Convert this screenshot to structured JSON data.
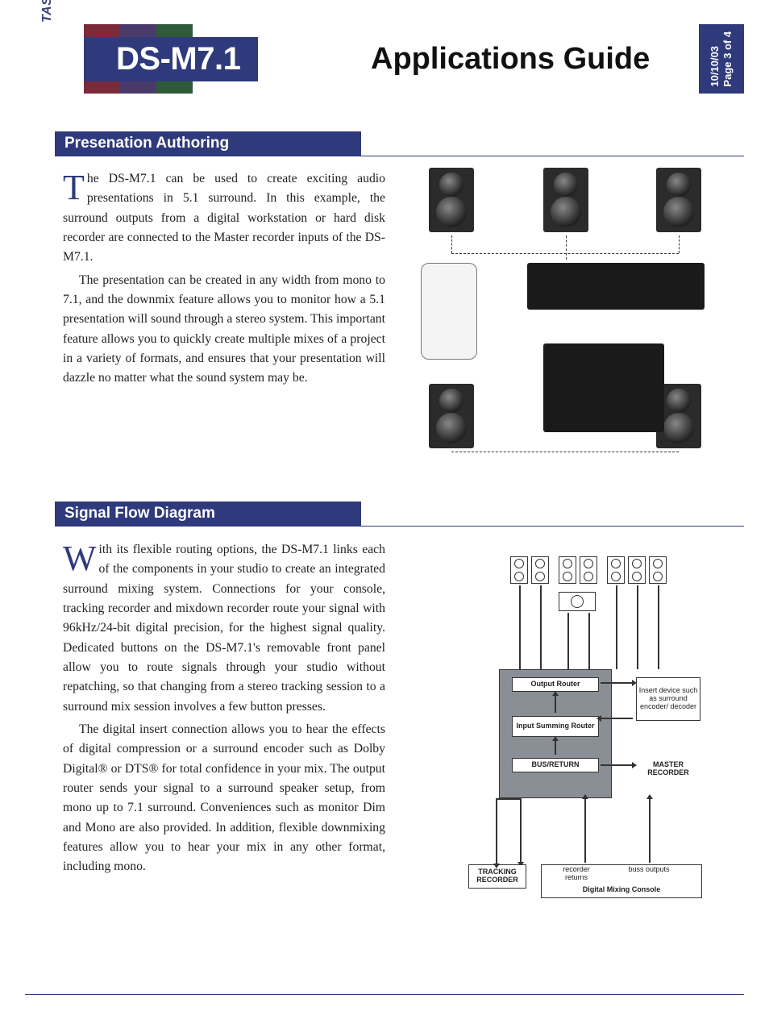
{
  "brand": "TASCAM",
  "model": "DS-M7.1",
  "doc_title": "Applications Guide",
  "date": "10/10/03",
  "page": "Page 3 of 4",
  "sections": {
    "s1": {
      "heading": "Presenation Authoring",
      "p1_first": "T",
      "p1_rest": "he DS-M7.1 can be used to create exciting audio presentations in 5.1 surround. In this example, the surround outputs from a digital workstation or hard disk recorder are connected to the Master recorder inputs of the DS-M7.1.",
      "p2": "The presentation can be created in any width from mono to 7.1, and the downmix feature allows you to monitor how a 5.1 presentation will sound through a stereo system. This important feature allows you to quickly create multiple mixes of a project in a variety of formats, and ensures that your presentation will dazzle no matter what the sound system may be."
    },
    "s2": {
      "heading": "Signal Flow Diagram",
      "p1_first": "W",
      "p1_rest": "ith its flexible routing options, the DS-M7.1 links each of the components in your studio to create an integrated surround mixing system. Connections for your console, tracking recorder and mixdown recorder route your signal with 96kHz/24-bit digital precision, for the highest signal quality. Dedicated buttons on the DS-M7.1's removable front panel allow you to route signals through your studio without repatching, so that changing from a stereo tracking session to a surround mix session involves a few button presses.",
      "p2": "The digital insert connection allows you to hear the effects of digital compression or a surround encoder such as Dolby Digital® or DTS® for total confidence in your mix. The output router sends your signal to a surround speaker setup, from mono up to 7.1 surround. Conveniences such as monitor Dim and Mono are also provided. In addition, flexible downmixing features allow you to hear your mix in any other format, including mono."
    }
  },
  "diagram": {
    "output_router": "Output Router",
    "input_summing": "Input Summing Router",
    "bus_return": "BUS/RETURN",
    "insert": "Insert device such as surround encoder/ decoder",
    "master_rec": "MASTER RECORDER",
    "tracking_rec": "TRACKING RECORDER",
    "rec_returns": "recorder returns",
    "buss_outputs": "buss outputs",
    "console": "Digital Mixing Console"
  }
}
